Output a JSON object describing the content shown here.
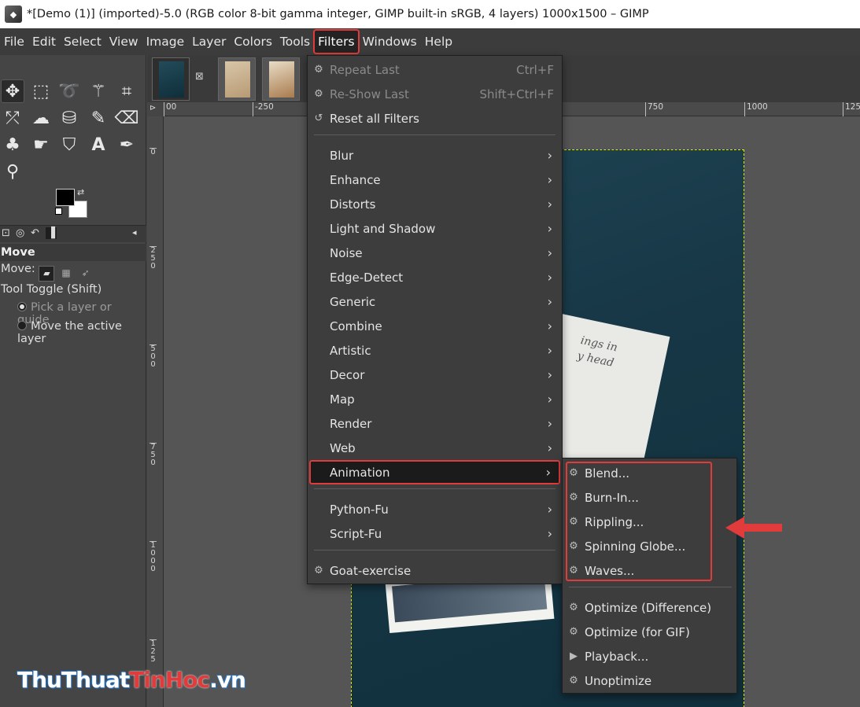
{
  "window": {
    "title": "*[Demo (1)] (imported)-5.0 (RGB color 8-bit gamma integer, GIMP built-in sRGB, 4 layers) 1000x1500 – GIMP"
  },
  "menubar": {
    "items": [
      {
        "label": "File"
      },
      {
        "label": "Edit"
      },
      {
        "label": "Select"
      },
      {
        "label": "View"
      },
      {
        "label": "Image"
      },
      {
        "label": "Layer"
      },
      {
        "label": "Colors"
      },
      {
        "label": "Tools"
      },
      {
        "label": "Filters",
        "active": true
      },
      {
        "label": "Windows"
      },
      {
        "label": "Help"
      }
    ]
  },
  "tool_options": {
    "title": "Move",
    "move_label": "Move:",
    "toggle_label": "Tool Toggle  (Shift)",
    "option_pick": "Pick a layer or guide",
    "option_move": "Move the active layer"
  },
  "rulers": {
    "top": [
      "00",
      "-250",
      "750",
      "1000",
      "125"
    ],
    "left": [
      [
        "0"
      ],
      [
        "2",
        "5",
        "0"
      ],
      [
        "5",
        "0",
        "0"
      ],
      [
        "7",
        "5",
        "0"
      ],
      [
        "1",
        "0",
        "0",
        "0"
      ],
      [
        "1",
        "2",
        "5"
      ]
    ]
  },
  "filters_menu": {
    "items": [
      {
        "label": "Repeat Last",
        "accel": "Ctrl+F",
        "disabled": true,
        "icon": "gear-icon"
      },
      {
        "label": "Re-Show Last",
        "accel": "Shift+Ctrl+F",
        "disabled": true,
        "icon": "reshow-icon"
      },
      {
        "label": "Reset all Filters",
        "icon": "reset-icon"
      },
      {
        "label": "Blur",
        "submenu": true
      },
      {
        "label": "Enhance",
        "submenu": true
      },
      {
        "label": "Distorts",
        "submenu": true
      },
      {
        "label": "Light and Shadow",
        "submenu": true
      },
      {
        "label": "Noise",
        "submenu": true
      },
      {
        "label": "Edge-Detect",
        "submenu": true
      },
      {
        "label": "Generic",
        "submenu": true
      },
      {
        "label": "Combine",
        "submenu": true
      },
      {
        "label": "Artistic",
        "submenu": true
      },
      {
        "label": "Decor",
        "submenu": true
      },
      {
        "label": "Map",
        "submenu": true
      },
      {
        "label": "Render",
        "submenu": true
      },
      {
        "label": "Web",
        "submenu": true
      },
      {
        "label": "Animation",
        "submenu": true,
        "highlighted": true
      },
      {
        "label": "Python-Fu",
        "submenu": true
      },
      {
        "label": "Script-Fu",
        "submenu": true
      },
      {
        "label": "Goat-exercise",
        "icon": "gear-icon"
      }
    ]
  },
  "animation_menu": {
    "items": [
      {
        "label": "Blend...",
        "icon": "gear-icon"
      },
      {
        "label": "Burn-In...",
        "icon": "gear-icon"
      },
      {
        "label": "Rippling...",
        "icon": "gear-icon"
      },
      {
        "label": "Spinning Globe...",
        "icon": "gear-icon"
      },
      {
        "label": "Waves...",
        "icon": "gear-icon"
      },
      {
        "label": "Optimize (Difference)",
        "icon": "gear-icon"
      },
      {
        "label": "Optimize (for GIF)",
        "icon": "gear-icon"
      },
      {
        "label": "Playback...",
        "icon": "play-icon"
      },
      {
        "label": "Unoptimize",
        "icon": "gear-icon"
      }
    ]
  },
  "image_text": {
    "note_line1": "ings in",
    "note_line2": "y head"
  },
  "watermark": {
    "part1": "ThuThuat",
    "part2": "TinHoc",
    "part3": ".vn"
  },
  "colors": {
    "highlight": "#e23b3b",
    "menu_bg": "#3d3d3d",
    "canvas_bg": "#555555"
  }
}
